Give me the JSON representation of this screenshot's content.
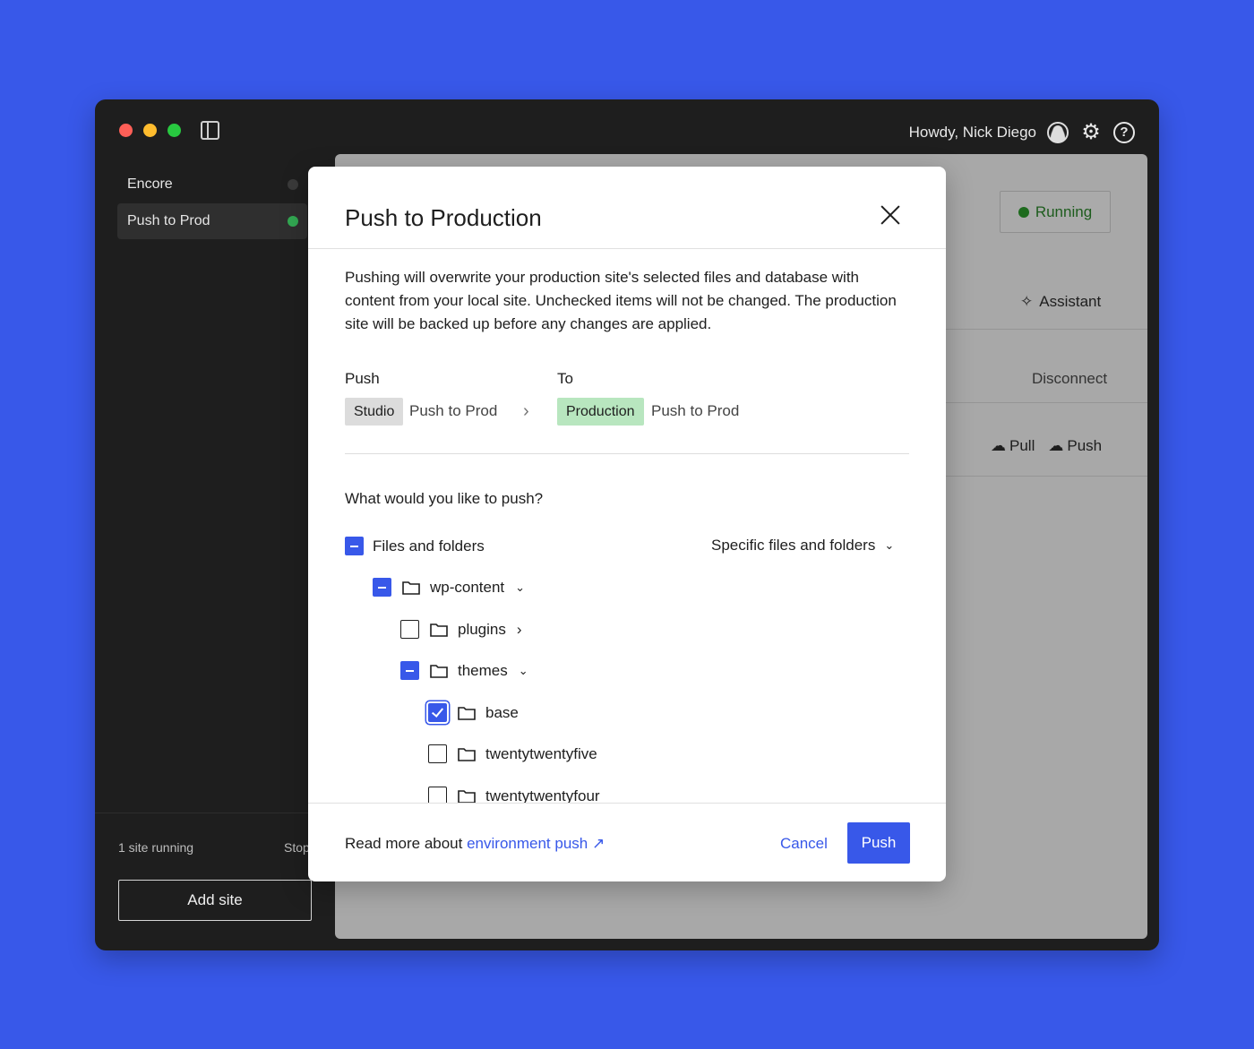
{
  "header": {
    "greeting": "Howdy, Nick Diego"
  },
  "sidebar": {
    "sites": [
      {
        "name": "Encore",
        "running": false
      },
      {
        "name": "Push to Prod",
        "running": true
      }
    ],
    "running_count": "1 site running",
    "stop_all": "Stop",
    "add_site": "Add site"
  },
  "main": {
    "status": "Running",
    "assistant": "Assistant",
    "disconnect": "Disconnect",
    "pull": "Pull",
    "push": "Push"
  },
  "modal": {
    "title": "Push to Production",
    "intro": "Pushing will overwrite your production site's selected files and database with content from your local site. Unchecked items will not be changed. The production site will be backed up before any changes are applied.",
    "push_label": "Push",
    "to_label": "To",
    "source_tag": "Studio",
    "source_site": "Push to Prod",
    "target_tag": "Production",
    "target_site": "Push to Prod",
    "question": "What would you like to push?",
    "scope_select": "Specific files and folders",
    "tree": {
      "root": "Files and folders",
      "wp_content": "wp-content",
      "plugins": "plugins",
      "themes": "themes",
      "base": "base",
      "twentytwentyfive": "twentytwentyfive",
      "twentytwentyfour": "twentytwentyfour"
    },
    "footer": {
      "read_more_prefix": "Read more about ",
      "read_more_link": "environment push ↗",
      "cancel": "Cancel",
      "push": "Push"
    }
  },
  "colors": {
    "accent": "#3858e9",
    "production_tag": "#b8e6bf",
    "running_green": "#32a852"
  }
}
